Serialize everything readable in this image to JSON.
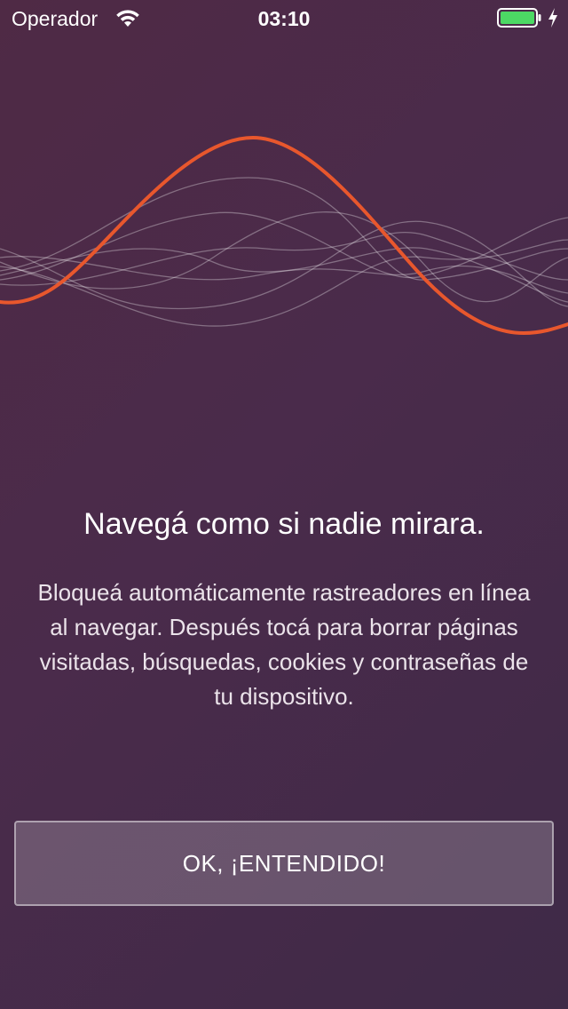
{
  "status_bar": {
    "carrier": "Operador",
    "time": "03:10",
    "battery_color": "#4cd964"
  },
  "onboarding": {
    "title": "Navegá como si nadie mirara.",
    "description": "Bloqueá automáticamente rastreadores en línea al navegar. Después tocá para borrar páginas visitadas, búsquedas, cookies y contraseñas de tu dispositivo.",
    "confirm_label": "OK, ¡ENTENDIDO!",
    "accent_wave_color": "#e8572d"
  },
  "icons": {
    "wifi": "wifi-icon",
    "battery": "battery-icon",
    "charging": "charging-bolt-icon",
    "illustration": "sound-waves-illustration"
  }
}
